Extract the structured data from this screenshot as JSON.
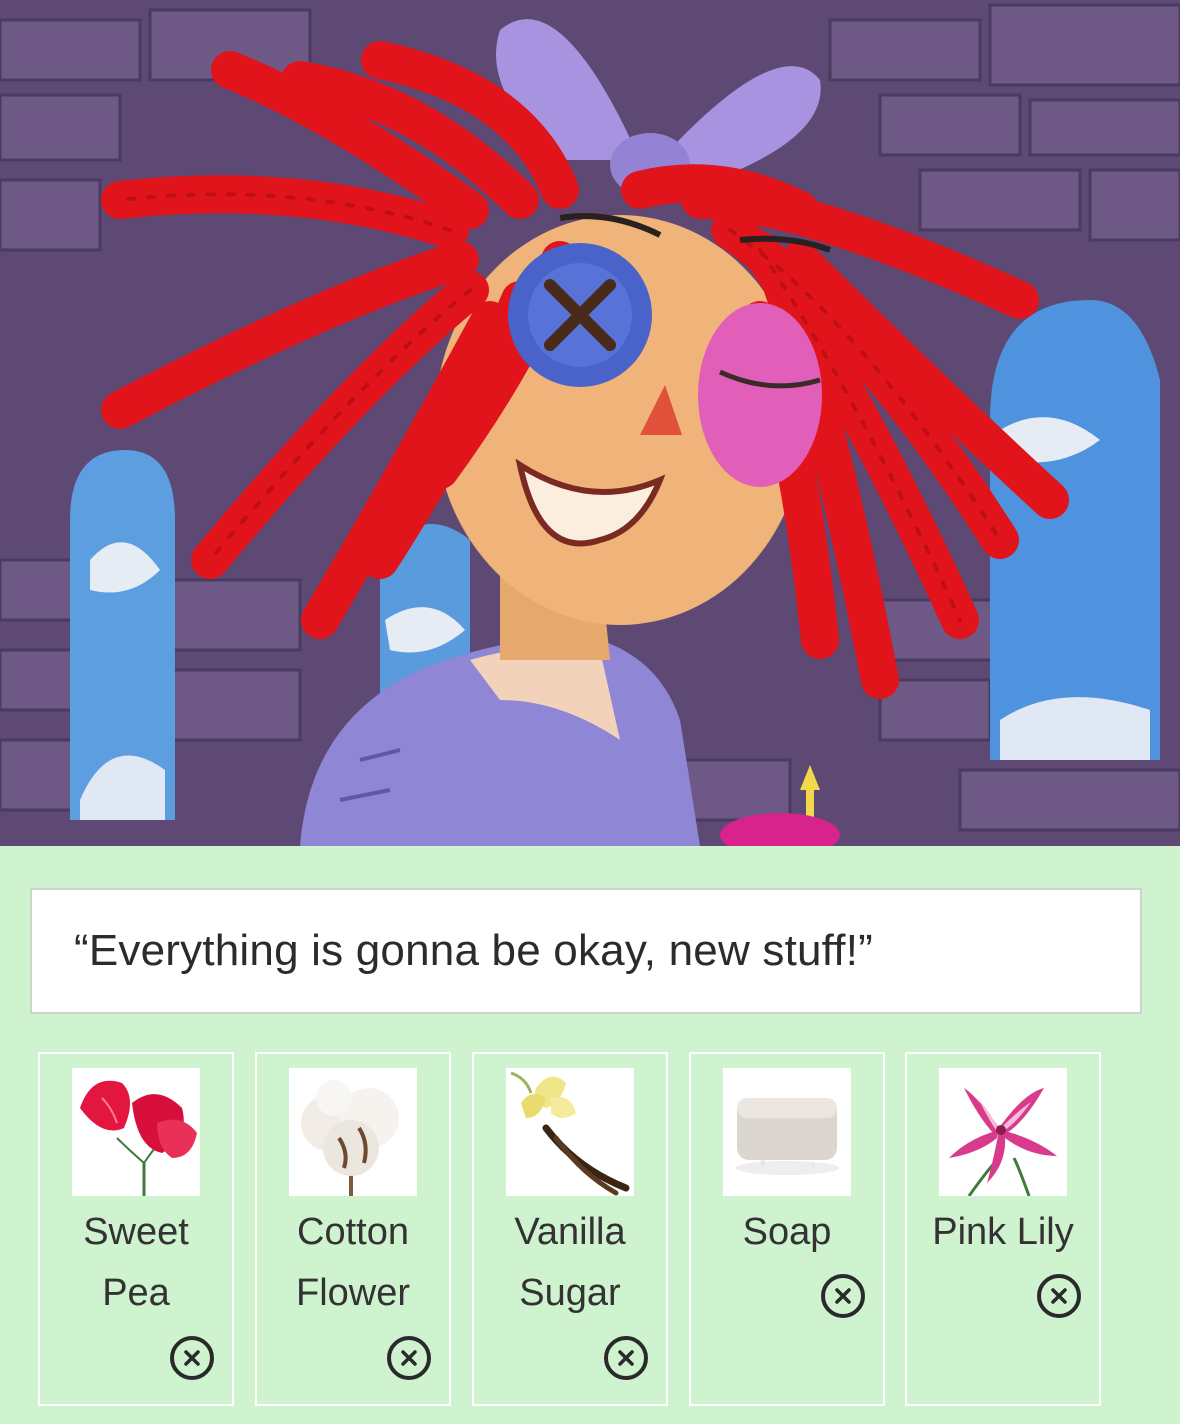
{
  "quote": "“Everything is gonna be okay, new stuff!”",
  "scents": [
    {
      "line1": "Sweet",
      "line2": "Pea",
      "icon": "sweet-pea-flower"
    },
    {
      "line1": "Cotton",
      "line2": "Flower",
      "icon": "cotton-boll"
    },
    {
      "line1": "Vanilla",
      "line2": "Sugar",
      "icon": "vanilla-flower"
    },
    {
      "line1": "Soap",
      "line2": "",
      "icon": "soap-bar"
    },
    {
      "line1": "Pink Lily",
      "line2": "",
      "icon": "pink-lily"
    }
  ],
  "remove_icon": "close-circle-icon",
  "colors": {
    "panel_bg": "#cff2cf",
    "card_border": "#ffffff",
    "hair": "#e0141a",
    "button_eye": "#4a63c9",
    "bow": "#a793e0",
    "shirt": "#8f86d6"
  }
}
